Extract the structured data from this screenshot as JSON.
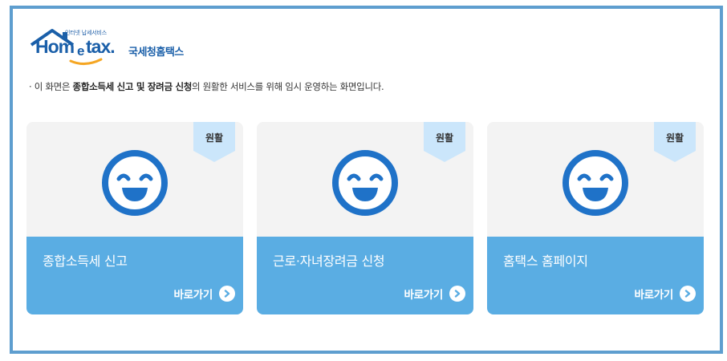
{
  "logo": {
    "tagline": "인터넷 납세서비스",
    "brand_home": "Hom",
    "brand_e": "e",
    "brand_tax": "tax.",
    "brand_korean": "국세청홈택스"
  },
  "notice": {
    "prefix": "· 이 화면은 ",
    "highlight": "종합소득세 신고 및 장려금 신청",
    "suffix": "의 원활한 서비스를 위해 임시 운영하는 화면입니다."
  },
  "cards": [
    {
      "status": "원활",
      "title": "종합소득세 신고",
      "link_label": "바로가기",
      "icon": "smiley-face-icon"
    },
    {
      "status": "원활",
      "title": "근로·자녀장려금 신청",
      "link_label": "바로가기",
      "icon": "smiley-face-icon"
    },
    {
      "status": "원활",
      "title": "홈택스 홈페이지",
      "link_label": "바로가기",
      "icon": "smiley-face-icon"
    }
  ],
  "colors": {
    "frame_border": "#5e9ecf",
    "card_bottom": "#5aade3",
    "ribbon": "#cbe6fb",
    "face": "#1f72c8",
    "brand": "#1a5fa9",
    "swoosh": "#f5a623"
  }
}
